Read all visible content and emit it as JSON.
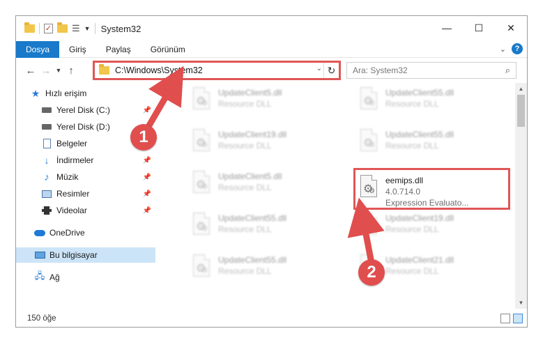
{
  "window": {
    "title": "System32",
    "minimize": "—",
    "maximize": "☐",
    "close": "✕"
  },
  "ribbon": {
    "tabs": [
      {
        "label": "Dosya",
        "active": true
      },
      {
        "label": "Giriş"
      },
      {
        "label": "Paylaş"
      },
      {
        "label": "Görünüm"
      }
    ],
    "help": "?",
    "collapse": "⌄"
  },
  "address": {
    "path": "C:\\Windows\\System32",
    "dropdown": "⌄",
    "refresh": "↻"
  },
  "search": {
    "placeholder": "Ara: System32"
  },
  "nav": {
    "items": [
      {
        "label": "Hızlı erişim",
        "icon": "star-icon"
      },
      {
        "label": "Yerel Disk (C:)",
        "icon": "disk-icon",
        "pinned": true
      },
      {
        "label": "Yerel Disk (D:)",
        "icon": "disk-icon"
      },
      {
        "label": "Belgeler",
        "icon": "document-icon",
        "pinned": true
      },
      {
        "label": "İndirmeler",
        "icon": "download-icon",
        "pinned": true
      },
      {
        "label": "Müzik",
        "icon": "music-icon",
        "pinned": true
      },
      {
        "label": "Resimler",
        "icon": "pictures-icon",
        "pinned": true
      },
      {
        "label": "Videolar",
        "icon": "video-icon",
        "pinned": true
      },
      {
        "label": "OneDrive",
        "icon": "cloud-icon"
      },
      {
        "label": "Bu bilgisayar",
        "icon": "computer-icon",
        "selected": true
      },
      {
        "label": "Ağ",
        "icon": "network-icon"
      }
    ]
  },
  "files": [
    {
      "name": "UpdateClient5.dll",
      "type": "Resource DLL"
    },
    {
      "name": "UpdateClient55.dll",
      "type": "Resource DLL"
    },
    {
      "name": "UpdateClient19.dll",
      "type": "Resource DLL"
    },
    {
      "name": "UpdateClient55.dll",
      "type": "Resource DLL"
    },
    {
      "name": "UpdateClient5.dll",
      "type": "Resource DLL"
    },
    {
      "name": "eemips.dll",
      "version": "4.0.714.0",
      "desc": "Expression Evaluato...",
      "highlighted": true
    },
    {
      "name": "UpdateClient55.dll",
      "type": "Resource DLL"
    },
    {
      "name": "UpdateClient19.dll",
      "type": "Resource DLL"
    },
    {
      "name": "UpdateClient55.dll",
      "type": "Resource DLL"
    },
    {
      "name": "UpdateClient21.dll",
      "type": "Resource DLL"
    }
  ],
  "status": {
    "count": "150 öğe"
  },
  "callouts": {
    "one": "1",
    "two": "2"
  },
  "colors": {
    "accent": "#1979ca",
    "highlight": "#e05656",
    "selected_nav": "#cce4f7"
  }
}
